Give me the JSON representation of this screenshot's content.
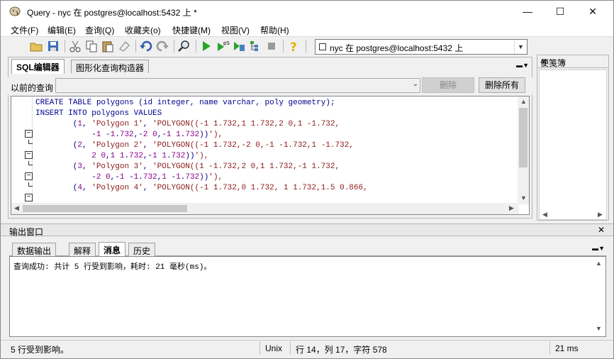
{
  "window": {
    "title": "Query - nyc 在  postgres@localhost:5432 上 *",
    "controls": {
      "minimize": "—",
      "maximize": "☐",
      "close": "✕"
    }
  },
  "menu": [
    "文件(F)",
    "编辑(E)",
    "查询(Q)",
    "收藏夹(o)",
    "快捷键(M)",
    "视图(V)",
    "帮助(H)"
  ],
  "toolbar": {
    "icons": [
      "open-file-icon",
      "save-icon",
      "cut-icon",
      "copy-icon",
      "paste-icon",
      "clear-icon",
      "undo-icon",
      "redo-icon",
      "find-icon",
      "execute-icon",
      "explain-icon",
      "execute-pgscript-icon",
      "execute-to-file-icon",
      "cancel-icon",
      "help-icon"
    ],
    "connection": "nyc 在  postgres@localhost:5432 上"
  },
  "sql_panel": {
    "tabs": [
      "SQL编辑器",
      "图形化查询构造器"
    ],
    "active_tab": 0,
    "history_label": "以前的查询",
    "delete_button": "删除",
    "delete_all_button": "删除所有",
    "code_lines": [
      "CREATE TABLE polygons (id integer, name varchar, poly geometry);",
      "",
      "INSERT INTO polygons VALUES",
      "        (1, 'Polygon 1', 'POLYGON((-1 1.732,1 1.732,2 0,1 -1.732,",
      "            -1 -1.732,-2 0,-1 1.732))'),",
      "        (2, 'Polygon 2', 'POLYGON((-1 1.732,-2 0,-1 -1.732,1 -1.732,",
      "            2 0,1 1.732,-1 1.732))'),",
      "        (3, 'Polygon 3', 'POLYGON((1 -1.732,2 0,1 1.732,-1 1.732,",
      "            -2 0,-1 -1.732,1 -1.732))'),",
      "        (4, 'Polygon 4', 'POLYGON((-1 1.732,0 1.732, 1 1.732,1.5 0.866,"
    ]
  },
  "clipboard_panel": {
    "title": "便笺簿"
  },
  "output_panel": {
    "title": "输出窗口",
    "tabs": [
      "数据输出",
      "解释",
      "消息",
      "历史"
    ],
    "active_tab": 2,
    "message": "查询成功: 共计 5 行受到影响，耗时: 21 毫秒(ms)。"
  },
  "status": {
    "rows": "5 行受到影响。",
    "line_ending": "Unix",
    "position": "行 14，列 17，字符 578",
    "time": "21 ms"
  }
}
